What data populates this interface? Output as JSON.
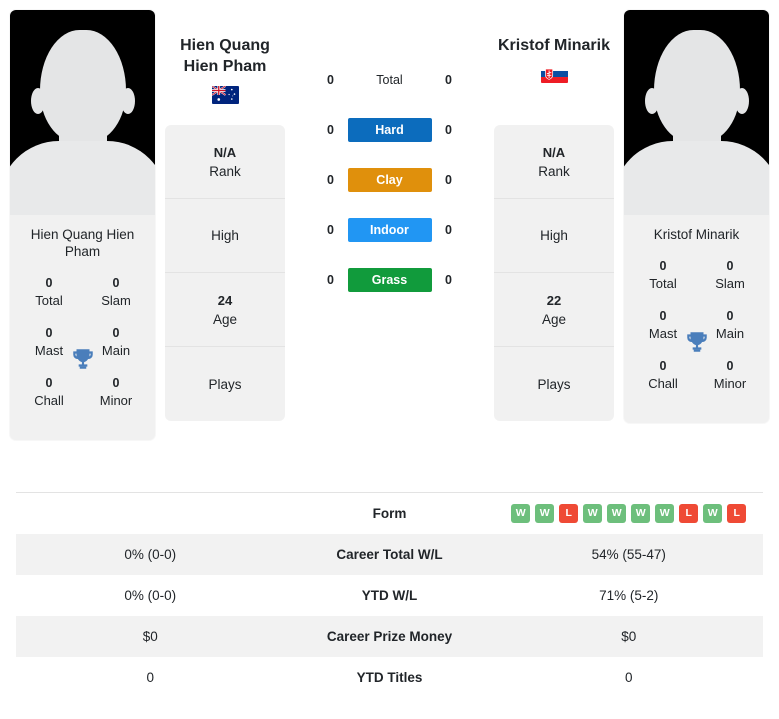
{
  "players": {
    "left": {
      "display_name": "Hien Quang Hien Pham",
      "header_name": "Hien Quang Hien Pham",
      "country": "Australia",
      "flag_icon": "australia-flag",
      "avatar_icon": "player-silhouette-avatar",
      "titles": {
        "total_value": "0",
        "total_label": "Total",
        "slam_value": "0",
        "slam_label": "Slam",
        "mast_value": "0",
        "mast_label": "Mast",
        "main_value": "0",
        "main_label": "Main",
        "chall_value": "0",
        "chall_label": "Chall",
        "minor_value": "0",
        "minor_label": "Minor",
        "trophy_icon": "trophy-icon"
      },
      "info": [
        {
          "value": "N/A",
          "label": "Rank"
        },
        {
          "value": "",
          "label": "High"
        },
        {
          "value": "24",
          "label": "Age"
        },
        {
          "value": "",
          "label": "Plays"
        }
      ]
    },
    "right": {
      "display_name": "Kristof Minarik",
      "header_name": "Kristof Minarik",
      "country": "Slovakia",
      "flag_icon": "slovakia-flag",
      "avatar_icon": "player-silhouette-avatar",
      "titles": {
        "total_value": "0",
        "total_label": "Total",
        "slam_value": "0",
        "slam_label": "Slam",
        "mast_value": "0",
        "mast_label": "Mast",
        "main_value": "0",
        "main_label": "Main",
        "chall_value": "0",
        "chall_label": "Chall",
        "minor_value": "0",
        "minor_label": "Minor",
        "trophy_icon": "trophy-icon"
      },
      "info": [
        {
          "value": "N/A",
          "label": "Rank"
        },
        {
          "value": "",
          "label": "High"
        },
        {
          "value": "22",
          "label": "Age"
        },
        {
          "value": "",
          "label": "Plays"
        }
      ]
    }
  },
  "surfaces": [
    {
      "label": "Total",
      "left": "0",
      "right": "0",
      "color": "none",
      "plain": true
    },
    {
      "label": "Hard",
      "left": "0",
      "right": "0",
      "color": "#0c6cbd",
      "plain": false
    },
    {
      "label": "Clay",
      "left": "0",
      "right": "0",
      "color": "#e0900c",
      "plain": false
    },
    {
      "label": "Indoor",
      "left": "0",
      "right": "0",
      "color": "#2196f3",
      "plain": false
    },
    {
      "label": "Grass",
      "left": "0",
      "right": "0",
      "color": "#119b3c",
      "plain": false
    }
  ],
  "comparison_rows": [
    {
      "label": "Form",
      "type": "form",
      "left": "",
      "right_form": [
        "W",
        "W",
        "L",
        "W",
        "W",
        "W",
        "W",
        "L",
        "W",
        "L"
      ],
      "shaded": false
    },
    {
      "label": "Career Total W/L",
      "type": "text",
      "left": "0% (0-0)",
      "right": "54% (55-47)",
      "shaded": true
    },
    {
      "label": "YTD W/L",
      "type": "text",
      "left": "0% (0-0)",
      "right": "71% (5-2)",
      "shaded": false
    },
    {
      "label": "Career Prize Money",
      "type": "text",
      "left": "$0",
      "right": "$0",
      "shaded": true
    },
    {
      "label": "YTD Titles",
      "type": "text",
      "left": "0",
      "right": "0",
      "shaded": false
    }
  ],
  "colors": {
    "hard": "#0c6cbd",
    "clay": "#e0900c",
    "indoor": "#2196f3",
    "grass": "#119b3c",
    "win_badge": "#6dbf7c",
    "loss_badge": "#ef4a35",
    "card_bg": "#f1f1f1",
    "row_shade": "#f2f2f2"
  }
}
